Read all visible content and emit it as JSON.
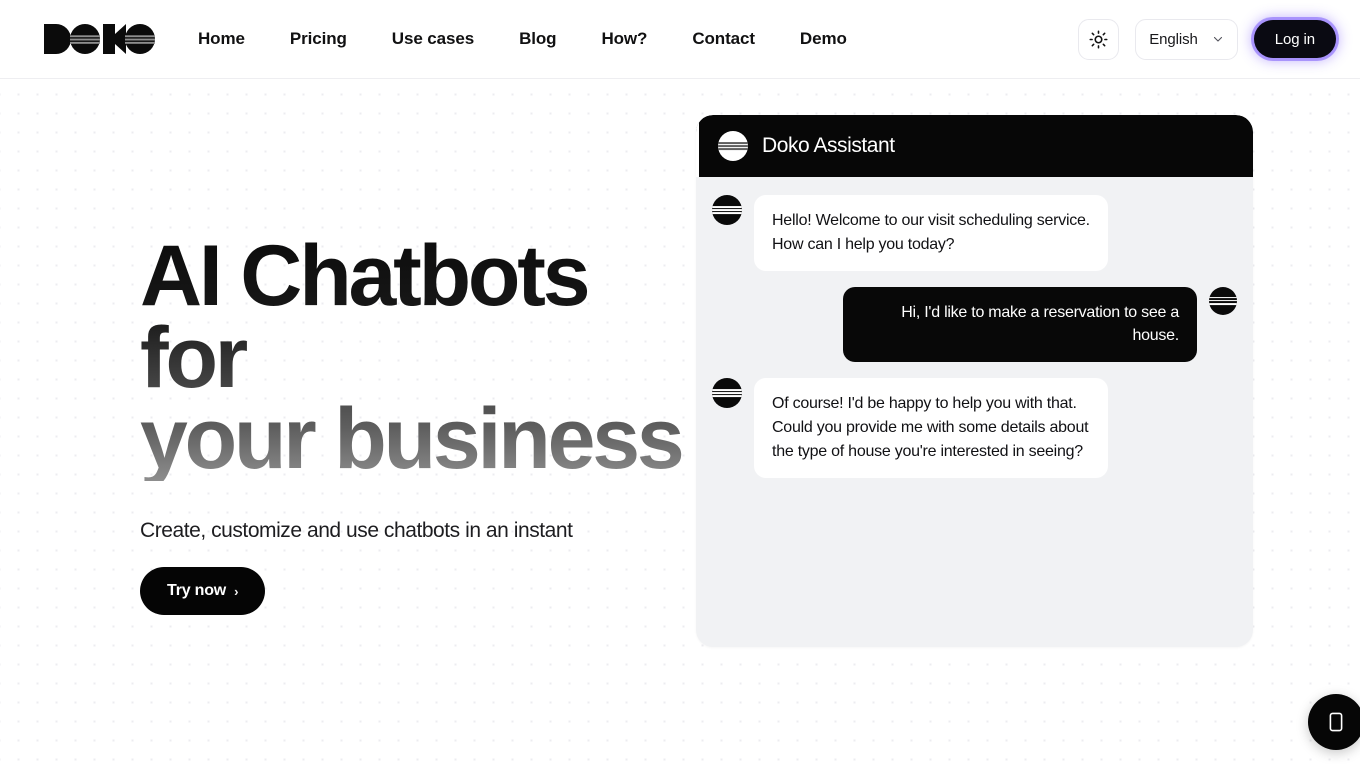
{
  "header": {
    "logo_alt": "DOKO",
    "nav": [
      {
        "label": "Home"
      },
      {
        "label": "Pricing"
      },
      {
        "label": "Use cases"
      },
      {
        "label": "Blog"
      },
      {
        "label": "How?"
      },
      {
        "label": "Contact"
      },
      {
        "label": "Demo"
      }
    ],
    "theme_toggle_icon": "sun-icon",
    "language": {
      "selected": "English",
      "chevron_icon": "chevron-down-icon"
    },
    "login_label": "Log in",
    "login_glow_color": "#7c5cfa"
  },
  "hero": {
    "title": "AI Chatbots for\nyour business",
    "subtitle": "Create, customize and use chatbots in an instant",
    "cta_label": "Try now",
    "cta_arrow": "›"
  },
  "chat": {
    "title": "Doko Assistant",
    "header_avatar_icon": "doko-logo-avatar-light",
    "messages": [
      {
        "sender": "bot",
        "text": "Hello! Welcome to our visit scheduling service. How can I help you today?",
        "avatar_icon": "doko-logo-avatar-dark"
      },
      {
        "sender": "user",
        "text": "Hi, I'd like to make a reservation to see a house.",
        "avatar_icon": "doko-logo-avatar-dark"
      },
      {
        "sender": "bot",
        "text": "Of course! I'd be happy to help you with that. Could you provide me with some details about the type of house you're interested in seeing?",
        "avatar_icon": "doko-logo-avatar-dark"
      }
    ]
  },
  "launcher": {
    "icon": "chat-bubble-icon",
    "label": ""
  },
  "colors": {
    "page_bg": "#ffffff",
    "dot_grid": "#ececf0",
    "chat_panel_bg": "#f1f2f4",
    "chat_header_bg": "#070707",
    "accent_dark": "#0a0a0a"
  }
}
